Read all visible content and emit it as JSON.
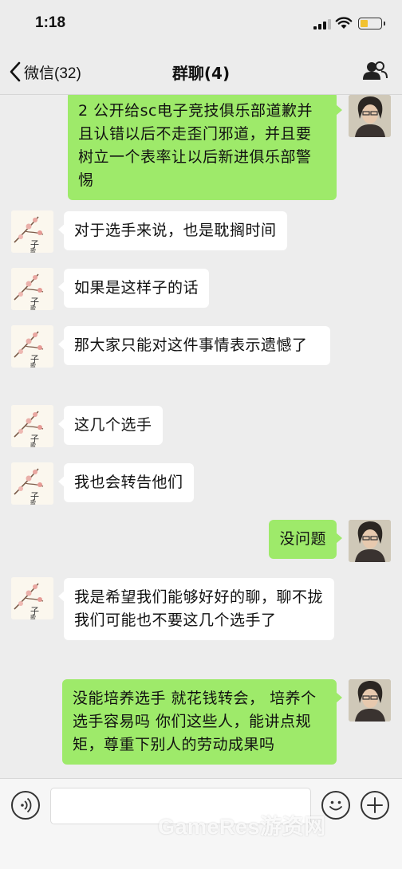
{
  "status_bar": {
    "time": "1:18"
  },
  "nav": {
    "back_label": "微信(32)",
    "title": "群聊(4)",
    "icons": {
      "back": "chevron-left-icon",
      "members": "people-icon"
    }
  },
  "messages": [
    {
      "side": "right",
      "text": "2 公开给sc电子竞技俱乐部道歉并且认错以后不走歪门邪道，并且要树立一个表率让以后新进俱乐部警惕",
      "avatar": "man-avatar"
    },
    {
      "side": "left",
      "text": "对于选手来说，也是耽搁时间",
      "avatar": "flower-avatar"
    },
    {
      "side": "left",
      "text": "如果是这样子的话",
      "avatar": "flower-avatar"
    },
    {
      "side": "left",
      "text": "那大家只能对这件事情表示遗憾了",
      "avatar": "flower-avatar"
    },
    {
      "side": "left",
      "text": "这几个选手",
      "avatar": "flower-avatar"
    },
    {
      "side": "left",
      "text": "我也会转告他们",
      "avatar": "flower-avatar"
    },
    {
      "side": "right",
      "text": "没问题",
      "avatar": "man-avatar"
    },
    {
      "side": "left",
      "text": "我是希望我们能够好好的聊，聊不拢 我们可能也不要这几个选手了",
      "avatar": "flower-avatar"
    },
    {
      "side": "right",
      "text": "没能培养选手 就花钱转会， 培养个选手容易吗 你们这些人，能讲点规矩，尊重下别人的劳动成果吗",
      "avatar": "man-avatar"
    }
  ],
  "input_bar": {
    "text_value": "",
    "icons": {
      "voice": "voice-icon",
      "emoji": "emoji-icon",
      "more": "plus-icon"
    }
  },
  "watermark": "GameRes游资网",
  "colors": {
    "outgoing_bubble": "#9eea6a",
    "incoming_bubble": "#ffffff",
    "background": "#ededed"
  }
}
